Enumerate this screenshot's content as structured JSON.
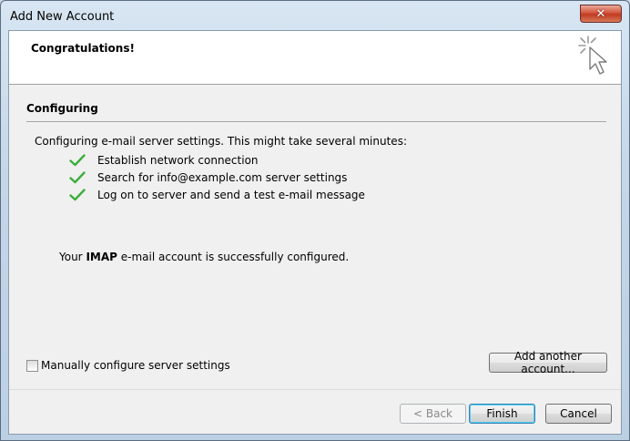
{
  "window": {
    "title": "Add New Account",
    "close_glyph": "✕"
  },
  "header": {
    "title": "Congratulations!",
    "icon": "cursor-sparkle-icon"
  },
  "section": {
    "title": "Configuring",
    "intro": "Configuring e-mail server settings. This might take several minutes:",
    "steps": [
      {
        "label": "Establish network connection",
        "status": "done"
      },
      {
        "label": "Search for info@example.com server settings",
        "status": "done"
      },
      {
        "label": "Log on to server and send a test e-mail message",
        "status": "done"
      }
    ],
    "result_prefix": "Your ",
    "result_protocol": "IMAP",
    "result_suffix": " e-mail account is successfully configured."
  },
  "options": {
    "manual_config_label": "Manually configure server settings",
    "manual_config_checked": false
  },
  "buttons": {
    "add_another": "Add another account...",
    "back": "< Back",
    "finish": "Finish",
    "cancel": "Cancel"
  },
  "colors": {
    "check_green": "#3cae3c",
    "close_red": "#c9452c"
  }
}
